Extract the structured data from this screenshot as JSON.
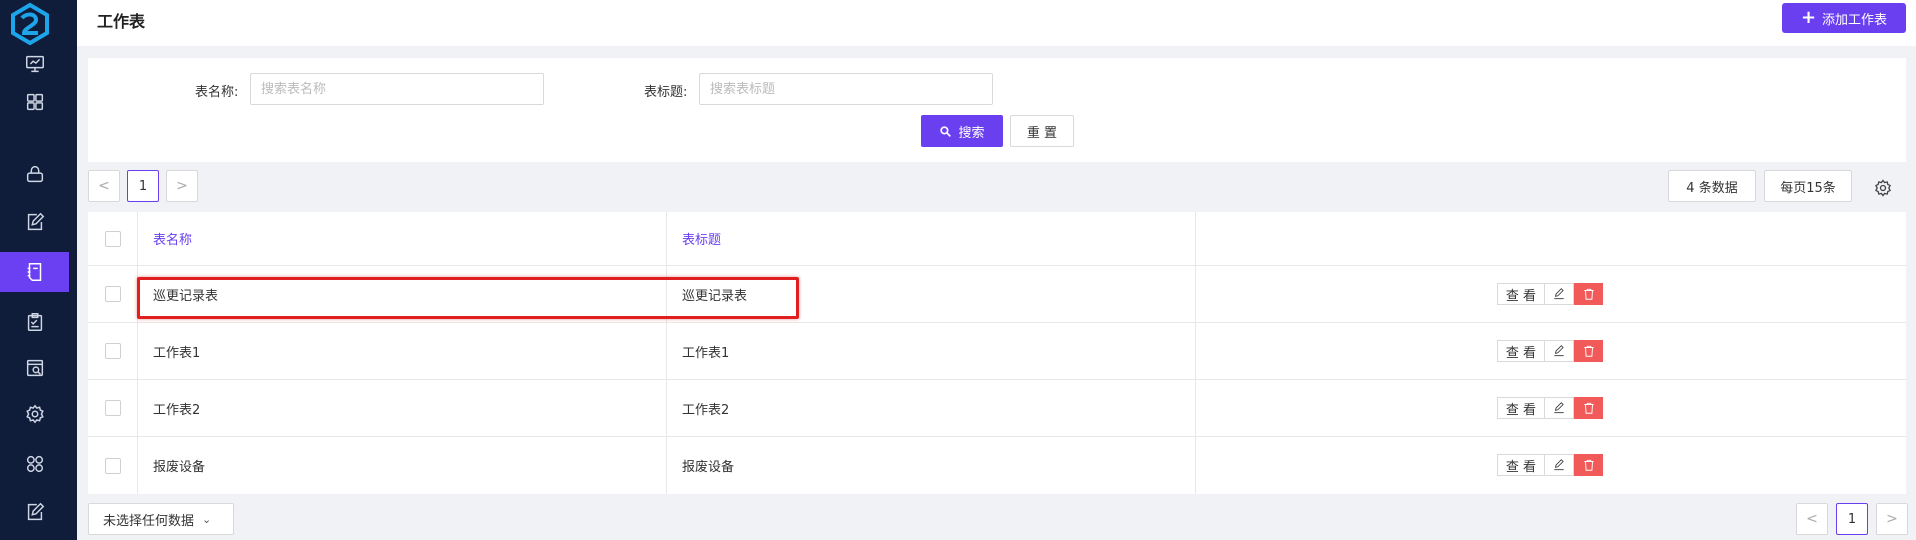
{
  "header": {
    "title": "工作表",
    "add_button": "添加工作表"
  },
  "sidebar": {
    "items": [
      {
        "icon": "monitor-icon",
        "active": false
      },
      {
        "icon": "grid-icon",
        "active": false
      },
      {
        "icon": "lock-icon",
        "active": false
      },
      {
        "icon": "edit-document-icon",
        "active": false
      },
      {
        "icon": "notebook-icon",
        "active": true
      },
      {
        "icon": "clipboard-check-icon",
        "active": false
      },
      {
        "icon": "search-document-icon",
        "active": false
      },
      {
        "icon": "gear-icon",
        "active": false
      },
      {
        "icon": "apps-icon",
        "active": false
      },
      {
        "icon": "edit-document-icon",
        "active": false
      }
    ]
  },
  "search": {
    "table_name_label": "表名称:",
    "table_name_placeholder": "搜索表名称",
    "table_title_label": "表标题:",
    "table_title_placeholder": "搜索表标题",
    "search_button": "搜索",
    "reset_button": "重 置"
  },
  "toolbar": {
    "prev": "<",
    "current_page": "1",
    "next": ">",
    "total": "4 条数据",
    "page_size": "每页15条"
  },
  "table": {
    "columns": [
      "表名称",
      "表标题"
    ],
    "rows": [
      {
        "name": "巡更记录表",
        "title": "巡更记录表"
      },
      {
        "name": "工作表1",
        "title": "工作表1"
      },
      {
        "name": "工作表2",
        "title": "工作表2"
      },
      {
        "name": "报废设备",
        "title": "报废设备"
      }
    ],
    "view_label": "查 看"
  },
  "footer": {
    "selection": "未选择任何数据",
    "prev": "<",
    "current_page": "1",
    "next": ">"
  },
  "colors": {
    "accent": "#6a3ff0",
    "sidebar": "#0f1d3a",
    "danger": "#f25a5a",
    "highlight": "#e02020"
  }
}
